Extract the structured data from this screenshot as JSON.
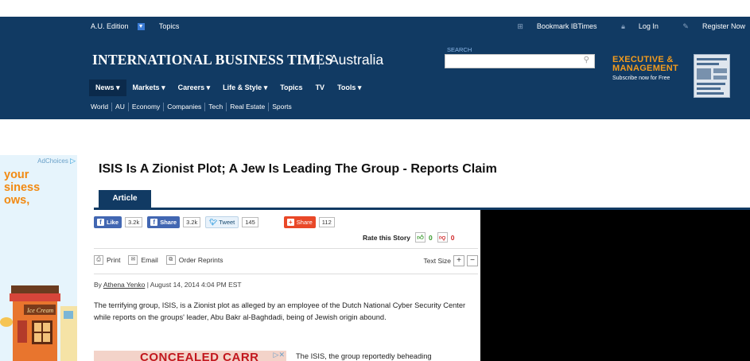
{
  "utility_bar": {
    "edition": "A.U. Edition",
    "topics": "Topics",
    "bookmark": "Bookmark IBTimes",
    "login": "Log In",
    "register": "Register Now"
  },
  "header": {
    "logo": "INTERNATIONAL BUSINESS TIMES",
    "edition_name": "Australia",
    "search_label": "SEARCH",
    "search_placeholder": ""
  },
  "promo": {
    "line1": "EXECUTIVE &",
    "line2": "MANAGEMENT",
    "sub": "Subscribe now for Free"
  },
  "nav": [
    "News",
    "Markets",
    "Careers",
    "Life & Style",
    "Topics",
    "TV",
    "Tools"
  ],
  "nav_has_dropdown": [
    true,
    true,
    true,
    true,
    false,
    false,
    true
  ],
  "subnav": [
    "World",
    "AU",
    "Economy",
    "Companies",
    "Tech",
    "Real Estate",
    "Sports"
  ],
  "left_ad": {
    "adchoices": "AdChoices",
    "text_lines": [
      "your",
      "siness",
      "ows,"
    ]
  },
  "article": {
    "title": "ISIS Is A Zionist Plot; A Jew Is Leading The Group - Reports Claim",
    "tab": "Article",
    "share": {
      "like_label": "Like",
      "like_count": "3.2k",
      "share_label": "Share",
      "share_count": "3.2k",
      "tweet_label": "Tweet",
      "tweet_count": "145",
      "addthis_label": "Share",
      "addthis_count": "112"
    },
    "rating": {
      "label": "Rate this Story",
      "up": "0",
      "down": "0"
    },
    "tools": {
      "print": "Print",
      "email": "Email",
      "reprints": "Order Reprints",
      "text_size": "Text Size",
      "plus": "+",
      "minus": "−"
    },
    "byline_prefix": "By",
    "author": "Athena Yenko",
    "byline_date": "| August 14, 2014 4:04 PM EST",
    "paragraph1": "The terrifying group, ISIS, is a Zionist plot as alleged by an employee of the Dutch National Cyber Security Center while reports on the groups' leader, Abu Bakr al-Baghdadi, being of Jewish origin abound.",
    "inline_ad": "CONCEALED CARR",
    "paragraph2_start": "The ISIS, the group reportedly beheading"
  },
  "colors": {
    "header_bg": "#113a63",
    "promo_orange": "#f29b1d",
    "facebook": "#4267b2",
    "addthis": "#e94828"
  }
}
